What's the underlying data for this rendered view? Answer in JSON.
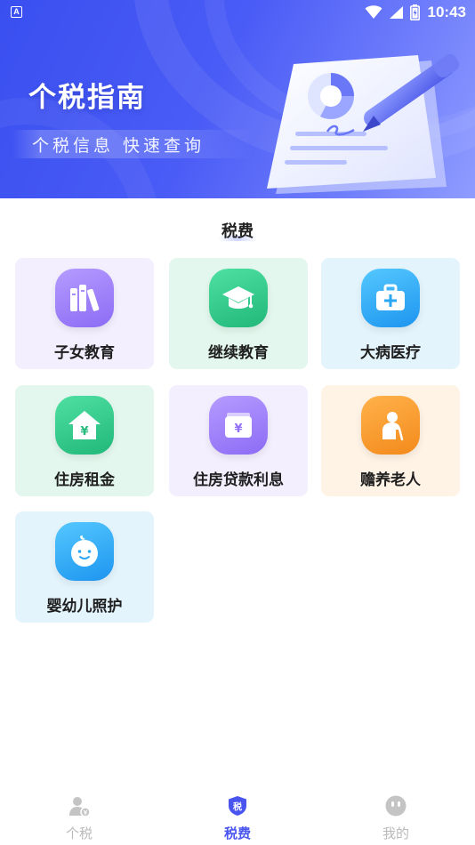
{
  "status_bar": {
    "time": "10:43",
    "notification_icon": "A"
  },
  "banner": {
    "title": "个税指南",
    "subtitle": "个税信息 快速查询"
  },
  "section": {
    "title": "税费"
  },
  "categories": [
    {
      "label": "子女教育",
      "icon": "books-icon",
      "theme": "purple"
    },
    {
      "label": "继续教育",
      "icon": "graduation-cap-icon",
      "theme": "green"
    },
    {
      "label": "大病医疗",
      "icon": "medical-kit-icon",
      "theme": "blue"
    },
    {
      "label": "住房租金",
      "icon": "house-yuan-icon",
      "theme": "green"
    },
    {
      "label": "住房贷款利息",
      "icon": "wallet-yuan-icon",
      "theme": "purple"
    },
    {
      "label": "赡养老人",
      "icon": "elderly-icon",
      "theme": "orange"
    },
    {
      "label": "婴幼儿照护",
      "icon": "baby-face-icon",
      "theme": "blue"
    }
  ],
  "tabbar": {
    "tabs": [
      {
        "label": "个税",
        "icon": "person-tax-icon",
        "active": false
      },
      {
        "label": "税费",
        "icon": "tax-shield-icon",
        "active": true,
        "icon_text": "税"
      },
      {
        "label": "我的",
        "icon": "face-icon",
        "active": false
      }
    ]
  },
  "colors": {
    "accent": "#4a55f0",
    "banner": "#3a4ff0",
    "tab_inactive": "#b9b9b9"
  }
}
